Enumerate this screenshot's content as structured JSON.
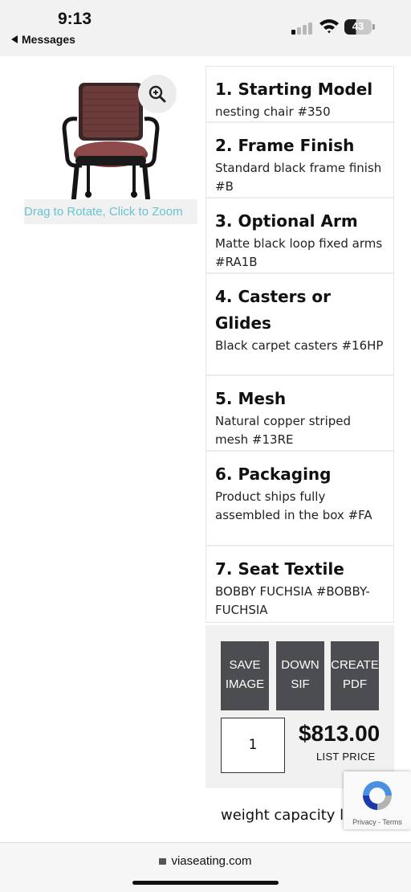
{
  "status_bar": {
    "time": "9:13",
    "back_label": "Messages",
    "battery": "43"
  },
  "product": {
    "hint": "Drag to Rotate, Click to Zoom",
    "zoom_icon": "zoom-in-icon"
  },
  "options": [
    {
      "title": "1. Starting Model",
      "value": "nesting chair #350"
    },
    {
      "title": "2. Frame Finish",
      "value": "Standard black frame finish #B"
    },
    {
      "title": "3. Optional Arm",
      "value": "Matte black loop fixed arms #RA1B"
    },
    {
      "title": "4. Casters or Glides",
      "value": "Black carpet casters #16HP"
    },
    {
      "title": "5. Mesh",
      "value": "Natural copper striped mesh #13RE"
    },
    {
      "title": "6. Packaging",
      "value": "Product ships fully assembled in the box #FA"
    },
    {
      "title": "7. Seat Textile",
      "value": "BOBBY FUCHSIA #BOBBY-FUCHSIA"
    }
  ],
  "actions": {
    "save_image": "SAVE IMAGE",
    "download_sif": "DOWN SIF",
    "create_pdf": "CREATE PDF",
    "quantity": "1",
    "price": "$813.00",
    "price_label": "LIST PRICE"
  },
  "weight_text": "weight capacity lb",
  "recaptcha": {
    "terms": "Privacy - Terms"
  },
  "browser": {
    "url": "viaseating.com"
  },
  "colors": {
    "button_bg": "#4b4d51",
    "hint_text": "#68c4cf",
    "seat": "#7a3a3c",
    "mesh": "#5a3030"
  }
}
